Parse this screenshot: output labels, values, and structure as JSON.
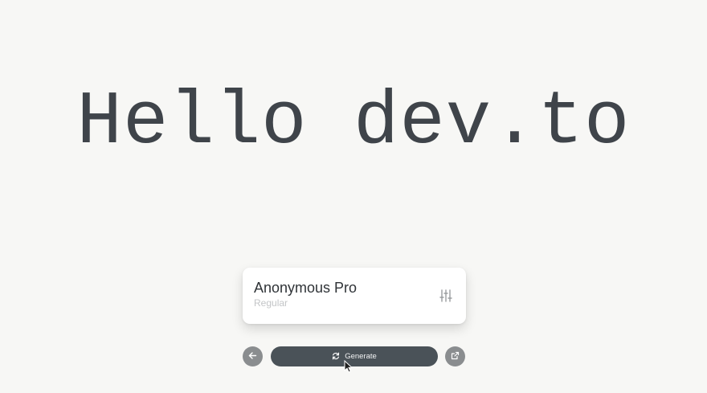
{
  "preview": {
    "text": "Hello dev.to"
  },
  "font_card": {
    "name": "Anonymous Pro",
    "style": "Regular",
    "settings_icon": "sliders-icon"
  },
  "controls": {
    "back_icon": "arrow-left-icon",
    "generate_label": "Generate",
    "generate_icon": "refresh-icon",
    "open_icon": "external-link-icon"
  },
  "colors": {
    "background": "#f7f7f5",
    "preview_text": "#3f444a",
    "generate_button": "#4a5258",
    "round_button": "#8a8d8f"
  }
}
